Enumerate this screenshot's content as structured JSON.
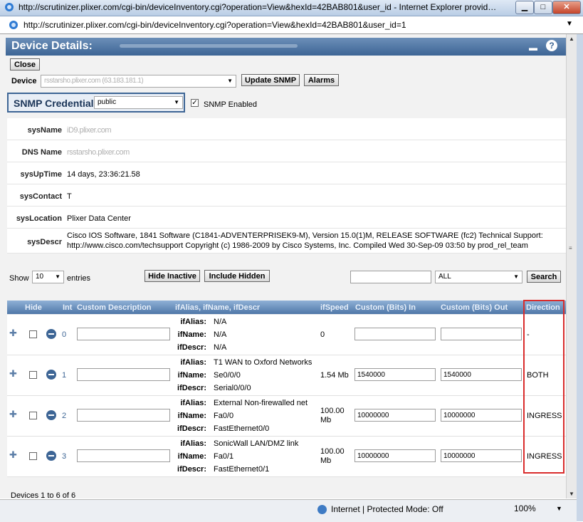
{
  "window": {
    "title": "http://scrutinizer.plixer.com/cgi-bin/deviceInventory.cgi?operation=View&hexId=42BAB801&user_id - Internet Explorer provid…",
    "url": "http://scrutinizer.plixer.com/cgi-bin/deviceInventory.cgi?operation=View&hexId=42BAB801&user_id=1",
    "min_label": "▁",
    "max_label": "□",
    "close_label": "✕"
  },
  "dialog": {
    "title": "Device Details:",
    "close_button": "Close",
    "device_label": "Device",
    "device_value": "rsstarsho.plixer.com (63.183.181.1)",
    "update_snmp_button": "Update SNMP",
    "alarms_button": "Alarms",
    "snmp_credential_label": "SNMP Credential",
    "snmp_credential_value": "public",
    "snmp_enabled_label": "SNMP Enabled",
    "snmp_enabled_checked": true
  },
  "info": {
    "sysName": {
      "label": "sysName",
      "value": "iD9.plixer.com"
    },
    "dnsName": {
      "label": "DNS Name",
      "value": "rsstarsho.plixer.com"
    },
    "sysUpTime": {
      "label": "sysUpTime",
      "value": "14 days, 23:36:21.58"
    },
    "sysContact": {
      "label": "sysContact",
      "value": "T"
    },
    "sysLocation": {
      "label": "sysLocation",
      "value": "Plixer Data Center"
    },
    "sysDescr": {
      "label": "sysDescr",
      "line1": "Cisco IOS Software, 1841 Software (C1841-ADVENTERPRISEK9-M), Version 15.0(1)M, RELEASE SOFTWARE (fc2) Technical Support:",
      "line2": "http://www.cisco.com/techsupport Copyright (c) 1986-2009 by Cisco Systems, Inc. Compiled Wed 30-Sep-09 03:50 by prod_rel_team"
    }
  },
  "controls": {
    "show_label": "Show",
    "show_value": "10",
    "entries_label": "entries",
    "hide_inactive_button": "Hide Inactive",
    "include_hidden_button": "Include Hidden",
    "search_placeholder": "",
    "filter_value": "ALL",
    "search_button": "Search"
  },
  "table": {
    "headers": {
      "hide": "Hide",
      "int": "Int",
      "custom_description": "Custom Description",
      "ifalias": "ifAlias, ifName, ifDescr",
      "ifspeed": "ifSpeed",
      "custom_in": "Custom (Bits) In",
      "custom_out": "Custom (Bits) Out",
      "direction": "Direction"
    },
    "field_labels": {
      "alias": "ifAlias:",
      "name": "ifName:",
      "descr": "ifDescr:"
    },
    "rows": [
      {
        "int": "0",
        "alias": "N/A",
        "name": "N/A",
        "descr": "N/A",
        "speed": "0",
        "in": "",
        "out": "",
        "direction": "-"
      },
      {
        "int": "1",
        "alias": "T1 WAN to Oxford Networks",
        "name": "Se0/0/0",
        "descr": "Serial0/0/0",
        "speed": "1.54 Mb",
        "in": "1540000",
        "out": "1540000",
        "direction": "BOTH"
      },
      {
        "int": "2",
        "alias": "External Non-firewalled net",
        "name": "Fa0/0",
        "descr": "FastEthernet0/0",
        "speed": "100.00\nMb",
        "in": "10000000",
        "out": "10000000",
        "direction": "INGRESS"
      },
      {
        "int": "3",
        "alias": "SonicWall LAN/DMZ link",
        "name": "Fa0/1",
        "descr": "FastEthernet0/1",
        "speed": "100.00\nMb",
        "in": "10000000",
        "out": "10000000",
        "direction": "INGRESS"
      }
    ]
  },
  "footer": {
    "text": "Devices 1 to 6 of 6"
  },
  "statusbar": {
    "zone": "Internet | Protected Mode: Off",
    "zoom": "100%"
  },
  "colors": {
    "header_blue": "#3d6595",
    "highlight_red": "#d92c2c"
  }
}
